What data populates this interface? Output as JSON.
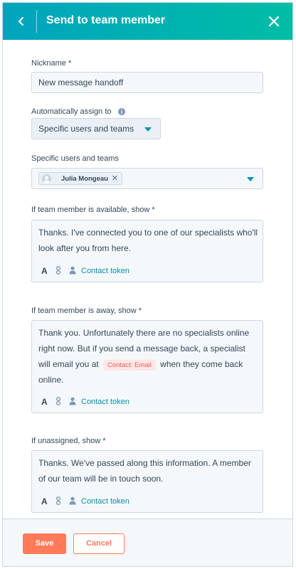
{
  "header": {
    "title": "Send to team member",
    "back_icon": "chevron-left-icon",
    "close_icon": "close-icon",
    "gradient": [
      "#00a4bd",
      "#00bda5"
    ]
  },
  "form": {
    "nickname": {
      "label": "Nickname *",
      "value": "New message handoff"
    },
    "assign": {
      "label": "Automatically assign to",
      "selected": "Specific users and teams"
    },
    "users_teams": {
      "label": "Specific users and teams",
      "chips": [
        {
          "name": "Julia Mongeau"
        }
      ]
    },
    "available": {
      "label": "If team member is available, show *",
      "text": "Thanks. I've connected you to one of our specialists who'll look after you from here."
    },
    "away": {
      "label": "If team member is away, show *",
      "text_before": "Thank you. Unfortunately there are no specialists online right now. But if you send a message back, a specialist will email you at",
      "token": "Contact: Email",
      "text_after": "when they come back online."
    },
    "unassigned": {
      "label": "If unassigned, show *",
      "text": "Thanks. We've passed along this information. A member of our team will be in touch soon."
    },
    "toolbar": {
      "format_glyph": "A",
      "token_label": "Contact token"
    }
  },
  "footer": {
    "save_label": "Save",
    "cancel_label": "Cancel"
  },
  "colors": {
    "accent": "#0091ae",
    "primary_button": "#ff7a59",
    "token_pill_bg": "#fde8e4",
    "token_pill_text": "#f2545b"
  }
}
